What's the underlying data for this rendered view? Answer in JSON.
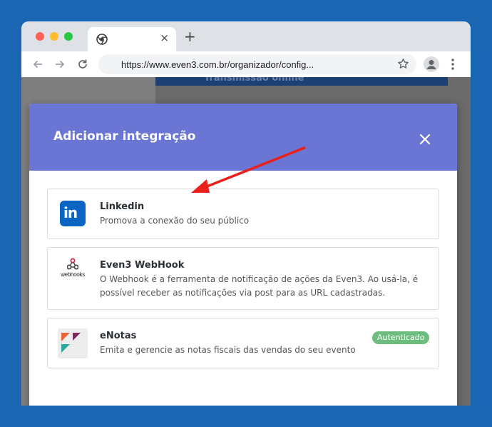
{
  "browser": {
    "tab_close": "×",
    "new_tab": "+",
    "url": "https://www.even3.com.br/organizador/config...",
    "background_banner": "Transmissão online"
  },
  "modal": {
    "title": "Adicionar integração",
    "close_label": "×"
  },
  "integrations": [
    {
      "name": "Linkedin",
      "description": "Promova a conexão do seu público",
      "logo_text": "in",
      "icon": "linkedin-logo"
    },
    {
      "name": "Even3 WebHook",
      "description": "O Webhook é a ferramenta de notificação de ações da Even3. Ao usá-la, é possível receber as notificações via post para as URL cadastradas.",
      "logo_text": "webhooks",
      "icon": "webhooks-logo"
    },
    {
      "name": "eNotas",
      "description": "Emita e gerencie as notas fiscais das vendas do seu evento",
      "badge": "Autenticado",
      "icon": "enotas-logo"
    }
  ],
  "colors": {
    "header": "#6b76d4",
    "badge": "#6dbd7e",
    "linkedin": "#0a66c2",
    "arrow": "#e8221a",
    "background": "#1a66b3"
  }
}
